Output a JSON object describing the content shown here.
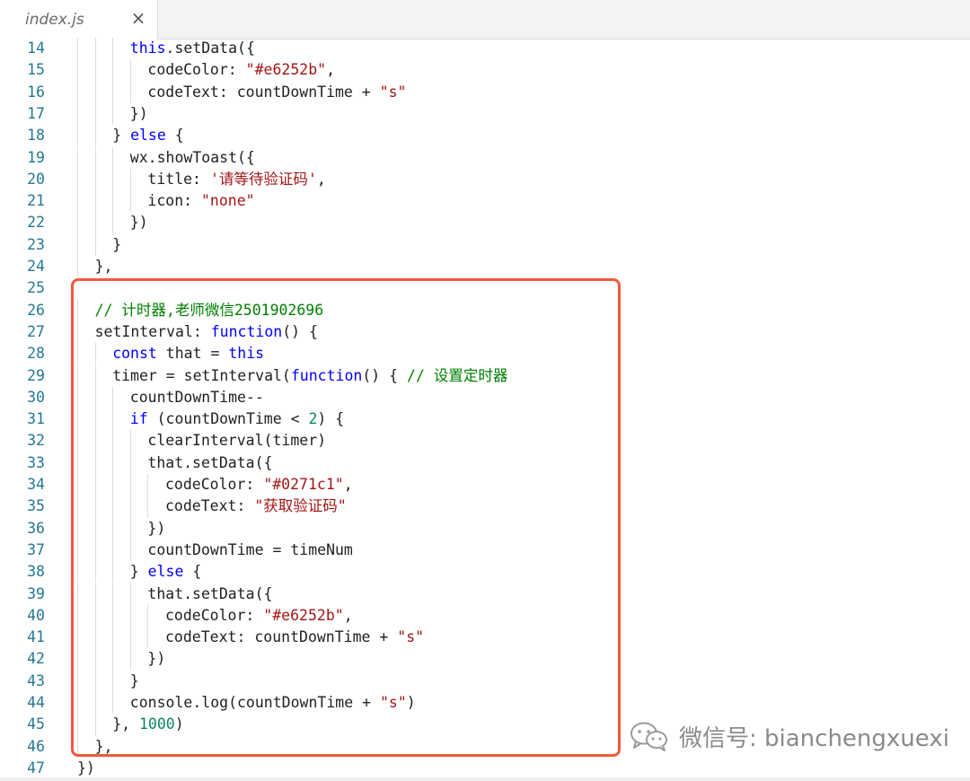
{
  "tab": {
    "label": "index.js"
  },
  "code": {
    "lines": [
      {
        "num": "14",
        "indent": 3,
        "parts": [
          {
            "t": "this",
            "c": "kw"
          },
          {
            "t": ".setData({"
          }
        ]
      },
      {
        "num": "15",
        "indent": 4,
        "parts": [
          {
            "t": "codeColor: "
          },
          {
            "t": "\"#e6252b\"",
            "c": "str"
          },
          {
            "t": ","
          }
        ]
      },
      {
        "num": "16",
        "indent": 4,
        "parts": [
          {
            "t": "codeText: countDownTime + "
          },
          {
            "t": "\"s\"",
            "c": "str"
          }
        ]
      },
      {
        "num": "17",
        "indent": 3,
        "parts": [
          {
            "t": "})"
          }
        ]
      },
      {
        "num": "18",
        "indent": 2,
        "parts": [
          {
            "t": "} "
          },
          {
            "t": "else",
            "c": "kw"
          },
          {
            "t": " {"
          }
        ]
      },
      {
        "num": "19",
        "indent": 3,
        "parts": [
          {
            "t": "wx.showToast({"
          }
        ]
      },
      {
        "num": "20",
        "indent": 4,
        "parts": [
          {
            "t": "title: "
          },
          {
            "t": "'请等待验证码'",
            "c": "str"
          },
          {
            "t": ","
          }
        ]
      },
      {
        "num": "21",
        "indent": 4,
        "parts": [
          {
            "t": "icon: "
          },
          {
            "t": "\"none\"",
            "c": "str"
          }
        ]
      },
      {
        "num": "22",
        "indent": 3,
        "parts": [
          {
            "t": "})"
          }
        ]
      },
      {
        "num": "23",
        "indent": 2,
        "parts": [
          {
            "t": "}"
          }
        ]
      },
      {
        "num": "24",
        "indent": 1,
        "parts": [
          {
            "t": "},"
          }
        ]
      },
      {
        "num": "25",
        "indent": 0,
        "parts": []
      },
      {
        "num": "26",
        "indent": 1,
        "parts": [
          {
            "t": "// 计时器,老师微信2501902696",
            "c": "cmt"
          }
        ]
      },
      {
        "num": "27",
        "indent": 1,
        "parts": [
          {
            "t": "setInterval: "
          },
          {
            "t": "function",
            "c": "kw"
          },
          {
            "t": "() {"
          }
        ]
      },
      {
        "num": "28",
        "indent": 2,
        "parts": [
          {
            "t": "const",
            "c": "kw"
          },
          {
            "t": " that = "
          },
          {
            "t": "this",
            "c": "kw"
          }
        ]
      },
      {
        "num": "29",
        "indent": 2,
        "parts": [
          {
            "t": "timer = setInterval("
          },
          {
            "t": "function",
            "c": "kw"
          },
          {
            "t": "() { "
          },
          {
            "t": "// 设置定时器",
            "c": "cmt"
          }
        ]
      },
      {
        "num": "30",
        "indent": 3,
        "parts": [
          {
            "t": "countDownTime--"
          }
        ]
      },
      {
        "num": "31",
        "indent": 3,
        "parts": [
          {
            "t": "if",
            "c": "kw"
          },
          {
            "t": " (countDownTime < "
          },
          {
            "t": "2",
            "c": "num"
          },
          {
            "t": ") {"
          }
        ]
      },
      {
        "num": "32",
        "indent": 4,
        "parts": [
          {
            "t": "clearInterval(timer)"
          }
        ]
      },
      {
        "num": "33",
        "indent": 4,
        "parts": [
          {
            "t": "that.setData({"
          }
        ]
      },
      {
        "num": "34",
        "indent": 5,
        "parts": [
          {
            "t": "codeColor: "
          },
          {
            "t": "\"#0271c1\"",
            "c": "str"
          },
          {
            "t": ","
          }
        ]
      },
      {
        "num": "35",
        "indent": 5,
        "parts": [
          {
            "t": "codeText: "
          },
          {
            "t": "\"获取验证码\"",
            "c": "str"
          }
        ]
      },
      {
        "num": "36",
        "indent": 4,
        "parts": [
          {
            "t": "})"
          }
        ]
      },
      {
        "num": "37",
        "indent": 4,
        "parts": [
          {
            "t": "countDownTime = timeNum"
          }
        ]
      },
      {
        "num": "38",
        "indent": 3,
        "parts": [
          {
            "t": "} "
          },
          {
            "t": "else",
            "c": "kw"
          },
          {
            "t": " {"
          }
        ]
      },
      {
        "num": "39",
        "indent": 4,
        "parts": [
          {
            "t": "that.setData({"
          }
        ]
      },
      {
        "num": "40",
        "indent": 5,
        "parts": [
          {
            "t": "codeColor: "
          },
          {
            "t": "\"#e6252b\"",
            "c": "str"
          },
          {
            "t": ","
          }
        ]
      },
      {
        "num": "41",
        "indent": 5,
        "parts": [
          {
            "t": "codeText: countDownTime + "
          },
          {
            "t": "\"s\"",
            "c": "str"
          }
        ]
      },
      {
        "num": "42",
        "indent": 4,
        "parts": [
          {
            "t": "})"
          }
        ]
      },
      {
        "num": "43",
        "indent": 3,
        "parts": [
          {
            "t": "}"
          }
        ]
      },
      {
        "num": "44",
        "indent": 3,
        "parts": [
          {
            "t": "console.log(countDownTime + "
          },
          {
            "t": "\"s\"",
            "c": "str"
          },
          {
            "t": ")"
          }
        ]
      },
      {
        "num": "45",
        "indent": 2,
        "parts": [
          {
            "t": "}, "
          },
          {
            "t": "1000",
            "c": "num"
          },
          {
            "t": ")"
          }
        ]
      },
      {
        "num": "46",
        "indent": 1,
        "parts": [
          {
            "t": "},"
          }
        ]
      },
      {
        "num": "47",
        "indent": 0,
        "parts": [
          {
            "t": "})"
          }
        ]
      }
    ]
  },
  "watermark": {
    "text": "微信号: bianchengxuexi",
    "icon": "wechat-icon"
  },
  "colors": {
    "keyword": "#0000ff",
    "string": "#a31515",
    "comment": "#008000",
    "number": "#098658",
    "line_number": "#237893",
    "highlight_border": "#f05a3c"
  }
}
